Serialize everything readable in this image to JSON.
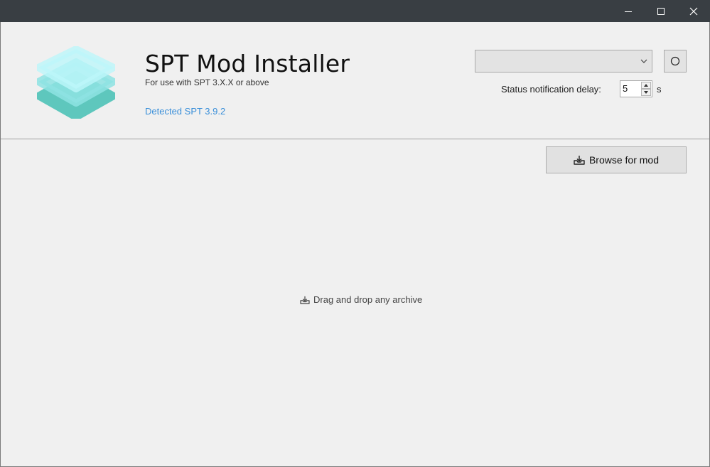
{
  "app": {
    "title": "SPT Mod Installer",
    "subtitle": "For use with SPT 3.X.X or above",
    "detected": "Detected SPT 3.9.2"
  },
  "controls": {
    "profile_select_value": "",
    "delay_label": "Status notification delay:",
    "delay_value": "5",
    "delay_unit": "s",
    "browse_label": "Browse for mod"
  },
  "dropzone": {
    "hint": "Drag and drop any archive"
  },
  "icons": {
    "logo": "layers-logo-icon",
    "refresh": "circle-icon",
    "browse": "install-tray-icon",
    "drop": "install-tray-icon"
  },
  "colors": {
    "titlebar": "#393e43",
    "background": "#f0f0f0",
    "link": "#3a8fd9",
    "logo_top": "#bdf6fa",
    "logo_mid": "#8ee3e3",
    "logo_bottom": "#5ec7bd"
  }
}
